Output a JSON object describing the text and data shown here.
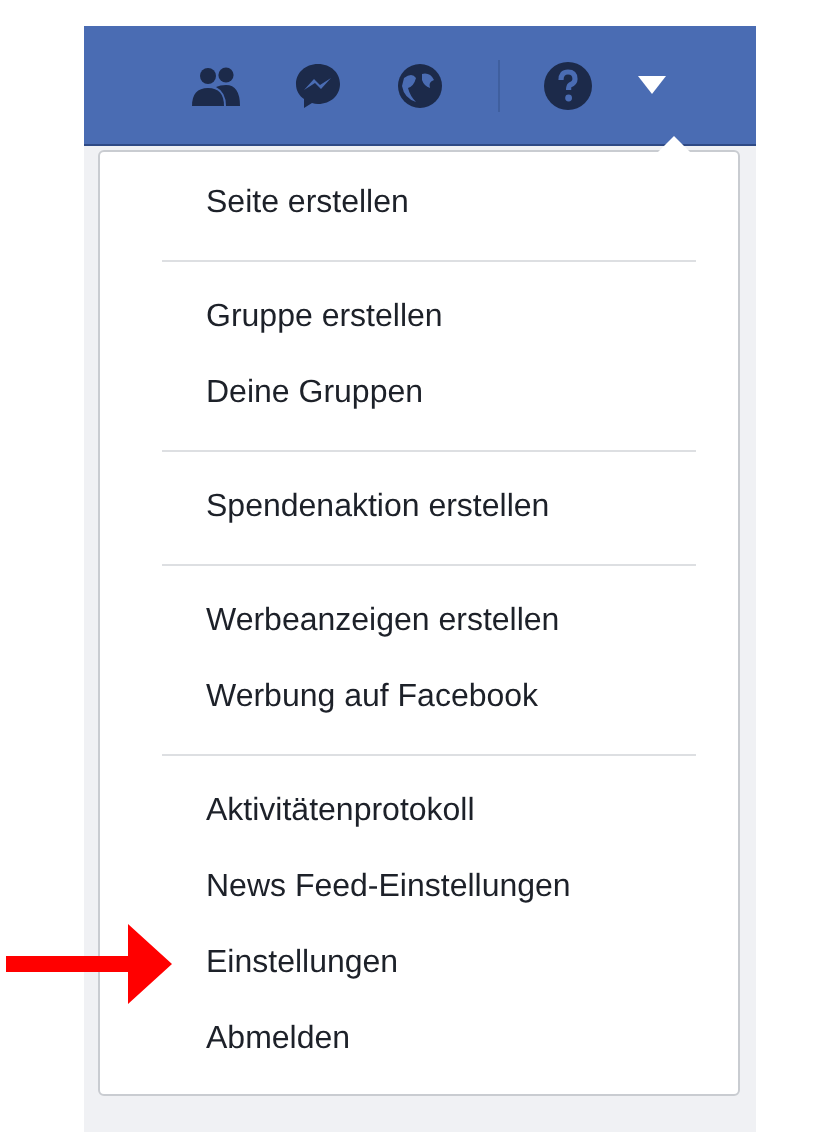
{
  "header": {
    "icons": [
      {
        "kind": "friends"
      },
      {
        "kind": "messages"
      },
      {
        "kind": "globe"
      },
      {
        "kind": "divider"
      },
      {
        "kind": "help"
      },
      {
        "kind": "caret"
      }
    ]
  },
  "menu": {
    "groups": [
      {
        "items": [
          {
            "label": "Seite erstellen",
            "highlighted": false
          }
        ]
      },
      {
        "items": [
          {
            "label": "Gruppe erstellen",
            "highlighted": false
          },
          {
            "label": "Deine Gruppen",
            "highlighted": false
          }
        ]
      },
      {
        "items": [
          {
            "label": "Spendenaktion erstellen",
            "highlighted": false
          }
        ]
      },
      {
        "items": [
          {
            "label": "Werbeanzeigen erstellen",
            "highlighted": false
          },
          {
            "label": "Werbung auf Facebook",
            "highlighted": false
          }
        ]
      },
      {
        "items": [
          {
            "label": "Aktivitätenprotokoll",
            "highlighted": false
          },
          {
            "label": "News Feed-Einstellungen",
            "highlighted": false
          },
          {
            "label": "Einstellungen",
            "highlighted": true
          },
          {
            "label": "Abmelden",
            "highlighted": false
          }
        ]
      }
    ]
  }
}
